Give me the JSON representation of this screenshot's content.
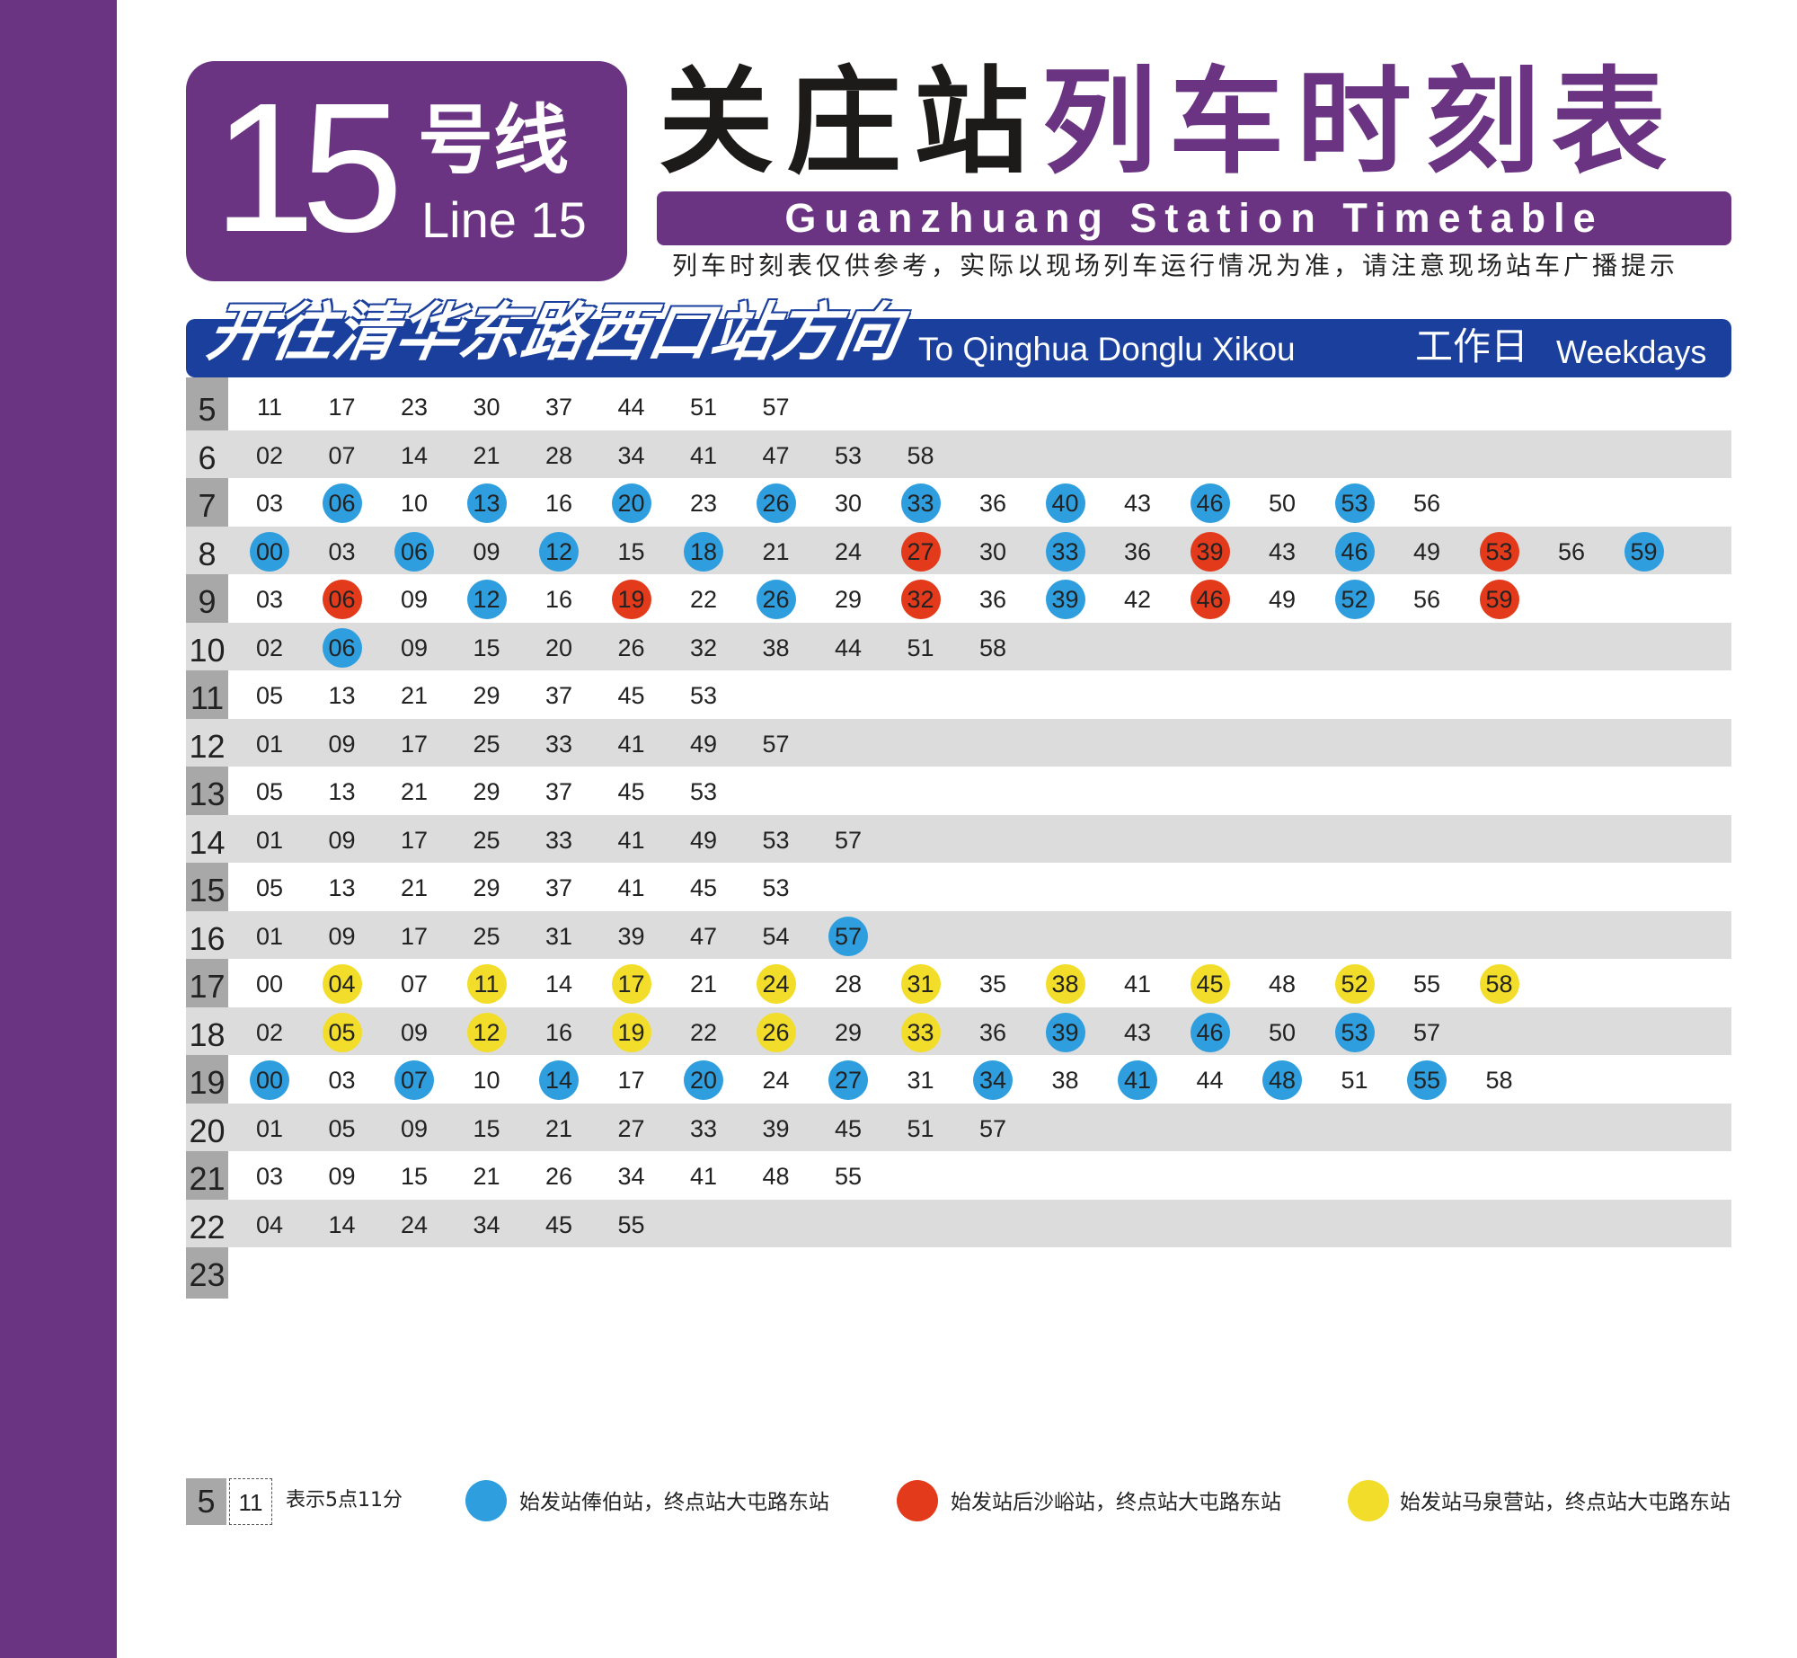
{
  "line": {
    "number": "15",
    "name_cn": "号线",
    "name_en": "Line 15"
  },
  "title": {
    "station_cn": "关庄站",
    "timetable_cn": "列车时刻表",
    "english": "Guanzhuang Station Timetable"
  },
  "notice": "列车时刻表仅供参考，实际以现场列车运行情况为准，请注意现场站车广播提示",
  "direction": {
    "cn": "开往清华东路西口站方向",
    "en": "To Qinghua Donglu Xikou"
  },
  "day_type": {
    "cn": "工作日",
    "en": "Weekdays"
  },
  "colors": {
    "purple": "#6b3483",
    "navy": "#1a3f9c",
    "blue": "#2f9ede",
    "red": "#e23a1a",
    "yellow": "#f2de2a",
    "gray": "#a8a8a8"
  },
  "schedule": [
    {
      "hour": "5",
      "minutes": [
        [
          "11",
          ""
        ],
        [
          "17",
          ""
        ],
        [
          "23",
          ""
        ],
        [
          "30",
          ""
        ],
        [
          "37",
          ""
        ],
        [
          "44",
          ""
        ],
        [
          "51",
          ""
        ],
        [
          "57",
          ""
        ]
      ]
    },
    {
      "hour": "6",
      "minutes": [
        [
          "02",
          ""
        ],
        [
          "07",
          ""
        ],
        [
          "14",
          ""
        ],
        [
          "21",
          ""
        ],
        [
          "28",
          ""
        ],
        [
          "34",
          ""
        ],
        [
          "41",
          ""
        ],
        [
          "47",
          ""
        ],
        [
          "53",
          ""
        ],
        [
          "58",
          ""
        ]
      ]
    },
    {
      "hour": "7",
      "minutes": [
        [
          "03",
          ""
        ],
        [
          "06",
          "blue"
        ],
        [
          "10",
          ""
        ],
        [
          "13",
          "blue"
        ],
        [
          "16",
          ""
        ],
        [
          "20",
          "blue"
        ],
        [
          "23",
          ""
        ],
        [
          "26",
          "blue"
        ],
        [
          "30",
          ""
        ],
        [
          "33",
          "blue"
        ],
        [
          "36",
          ""
        ],
        [
          "40",
          "blue"
        ],
        [
          "43",
          ""
        ],
        [
          "46",
          "blue"
        ],
        [
          "50",
          ""
        ],
        [
          "53",
          "blue"
        ],
        [
          "56",
          ""
        ]
      ]
    },
    {
      "hour": "8",
      "minutes": [
        [
          "00",
          "blue"
        ],
        [
          "03",
          ""
        ],
        [
          "06",
          "blue"
        ],
        [
          "09",
          ""
        ],
        [
          "12",
          "blue"
        ],
        [
          "15",
          ""
        ],
        [
          "18",
          "blue"
        ],
        [
          "21",
          ""
        ],
        [
          "24",
          ""
        ],
        [
          "27",
          "red"
        ],
        [
          "30",
          ""
        ],
        [
          "33",
          "blue"
        ],
        [
          "36",
          ""
        ],
        [
          "39",
          "red"
        ],
        [
          "43",
          ""
        ],
        [
          "46",
          "blue"
        ],
        [
          "49",
          ""
        ],
        [
          "53",
          "red"
        ],
        [
          "56",
          ""
        ],
        [
          "59",
          "blue"
        ]
      ]
    },
    {
      "hour": "9",
      "minutes": [
        [
          "03",
          ""
        ],
        [
          "06",
          "red"
        ],
        [
          "09",
          ""
        ],
        [
          "12",
          "blue"
        ],
        [
          "16",
          ""
        ],
        [
          "19",
          "red"
        ],
        [
          "22",
          ""
        ],
        [
          "26",
          "blue"
        ],
        [
          "29",
          ""
        ],
        [
          "32",
          "red"
        ],
        [
          "36",
          ""
        ],
        [
          "39",
          "blue"
        ],
        [
          "42",
          ""
        ],
        [
          "46",
          "red"
        ],
        [
          "49",
          ""
        ],
        [
          "52",
          "blue"
        ],
        [
          "56",
          ""
        ],
        [
          "59",
          "red"
        ]
      ]
    },
    {
      "hour": "10",
      "minutes": [
        [
          "02",
          ""
        ],
        [
          "06",
          "blue"
        ],
        [
          "09",
          ""
        ],
        [
          "15",
          ""
        ],
        [
          "20",
          ""
        ],
        [
          "26",
          ""
        ],
        [
          "32",
          ""
        ],
        [
          "38",
          ""
        ],
        [
          "44",
          ""
        ],
        [
          "51",
          ""
        ],
        [
          "58",
          ""
        ]
      ]
    },
    {
      "hour": "11",
      "minutes": [
        [
          "05",
          ""
        ],
        [
          "13",
          ""
        ],
        [
          "21",
          ""
        ],
        [
          "29",
          ""
        ],
        [
          "37",
          ""
        ],
        [
          "45",
          ""
        ],
        [
          "53",
          ""
        ]
      ]
    },
    {
      "hour": "12",
      "minutes": [
        [
          "01",
          ""
        ],
        [
          "09",
          ""
        ],
        [
          "17",
          ""
        ],
        [
          "25",
          ""
        ],
        [
          "33",
          ""
        ],
        [
          "41",
          ""
        ],
        [
          "49",
          ""
        ],
        [
          "57",
          ""
        ]
      ]
    },
    {
      "hour": "13",
      "minutes": [
        [
          "05",
          ""
        ],
        [
          "13",
          ""
        ],
        [
          "21",
          ""
        ],
        [
          "29",
          ""
        ],
        [
          "37",
          ""
        ],
        [
          "45",
          ""
        ],
        [
          "53",
          ""
        ]
      ]
    },
    {
      "hour": "14",
      "minutes": [
        [
          "01",
          ""
        ],
        [
          "09",
          ""
        ],
        [
          "17",
          ""
        ],
        [
          "25",
          ""
        ],
        [
          "33",
          ""
        ],
        [
          "41",
          ""
        ],
        [
          "49",
          ""
        ],
        [
          "53",
          ""
        ],
        [
          "57",
          ""
        ]
      ]
    },
    {
      "hour": "15",
      "minutes": [
        [
          "05",
          ""
        ],
        [
          "13",
          ""
        ],
        [
          "21",
          ""
        ],
        [
          "29",
          ""
        ],
        [
          "37",
          ""
        ],
        [
          "41",
          ""
        ],
        [
          "45",
          ""
        ],
        [
          "53",
          ""
        ]
      ]
    },
    {
      "hour": "16",
      "minutes": [
        [
          "01",
          ""
        ],
        [
          "09",
          ""
        ],
        [
          "17",
          ""
        ],
        [
          "25",
          ""
        ],
        [
          "31",
          ""
        ],
        [
          "39",
          ""
        ],
        [
          "47",
          ""
        ],
        [
          "54",
          ""
        ],
        [
          "57",
          "blue"
        ]
      ]
    },
    {
      "hour": "17",
      "minutes": [
        [
          "00",
          ""
        ],
        [
          "04",
          "yellow"
        ],
        [
          "07",
          ""
        ],
        [
          "11",
          "yellow"
        ],
        [
          "14",
          ""
        ],
        [
          "17",
          "yellow"
        ],
        [
          "21",
          ""
        ],
        [
          "24",
          "yellow"
        ],
        [
          "28",
          ""
        ],
        [
          "31",
          "yellow"
        ],
        [
          "35",
          ""
        ],
        [
          "38",
          "yellow"
        ],
        [
          "41",
          ""
        ],
        [
          "45",
          "yellow"
        ],
        [
          "48",
          ""
        ],
        [
          "52",
          "yellow"
        ],
        [
          "55",
          ""
        ],
        [
          "58",
          "yellow"
        ]
      ]
    },
    {
      "hour": "18",
      "minutes": [
        [
          "02",
          ""
        ],
        [
          "05",
          "yellow"
        ],
        [
          "09",
          ""
        ],
        [
          "12",
          "yellow"
        ],
        [
          "16",
          ""
        ],
        [
          "19",
          "yellow"
        ],
        [
          "22",
          ""
        ],
        [
          "26",
          "yellow"
        ],
        [
          "29",
          ""
        ],
        [
          "33",
          "yellow"
        ],
        [
          "36",
          ""
        ],
        [
          "39",
          "blue"
        ],
        [
          "43",
          ""
        ],
        [
          "46",
          "blue"
        ],
        [
          "50",
          ""
        ],
        [
          "53",
          "blue"
        ],
        [
          "57",
          ""
        ]
      ]
    },
    {
      "hour": "19",
      "minutes": [
        [
          "00",
          "blue"
        ],
        [
          "03",
          ""
        ],
        [
          "07",
          "blue"
        ],
        [
          "10",
          ""
        ],
        [
          "14",
          "blue"
        ],
        [
          "17",
          ""
        ],
        [
          "20",
          "blue"
        ],
        [
          "24",
          ""
        ],
        [
          "27",
          "blue"
        ],
        [
          "31",
          ""
        ],
        [
          "34",
          "blue"
        ],
        [
          "38",
          ""
        ],
        [
          "41",
          "blue"
        ],
        [
          "44",
          ""
        ],
        [
          "48",
          "blue"
        ],
        [
          "51",
          ""
        ],
        [
          "55",
          "blue"
        ],
        [
          "58",
          ""
        ]
      ]
    },
    {
      "hour": "20",
      "minutes": [
        [
          "01",
          ""
        ],
        [
          "05",
          ""
        ],
        [
          "09",
          ""
        ],
        [
          "15",
          ""
        ],
        [
          "21",
          ""
        ],
        [
          "27",
          ""
        ],
        [
          "33",
          ""
        ],
        [
          "39",
          ""
        ],
        [
          "45",
          ""
        ],
        [
          "51",
          ""
        ],
        [
          "57",
          ""
        ]
      ]
    },
    {
      "hour": "21",
      "minutes": [
        [
          "03",
          ""
        ],
        [
          "09",
          ""
        ],
        [
          "15",
          ""
        ],
        [
          "21",
          ""
        ],
        [
          "26",
          ""
        ],
        [
          "34",
          ""
        ],
        [
          "41",
          ""
        ],
        [
          "48",
          ""
        ],
        [
          "55",
          ""
        ]
      ]
    },
    {
      "hour": "22",
      "minutes": [
        [
          "04",
          ""
        ],
        [
          "14",
          ""
        ],
        [
          "24",
          ""
        ],
        [
          "34",
          ""
        ],
        [
          "45",
          ""
        ],
        [
          "55",
          ""
        ]
      ]
    },
    {
      "hour": "23",
      "minutes": []
    }
  ],
  "legend": {
    "example_hour": "5",
    "example_minute": "11",
    "example_text": "表示5点11分",
    "items": [
      {
        "color": "blue",
        "text": "始发站俸伯站，终点站大屯路东站"
      },
      {
        "color": "red",
        "text": "始发站后沙峪站，终点站大屯路东站"
      },
      {
        "color": "yellow",
        "text": "始发站马泉营站，终点站大屯路东站"
      }
    ]
  }
}
